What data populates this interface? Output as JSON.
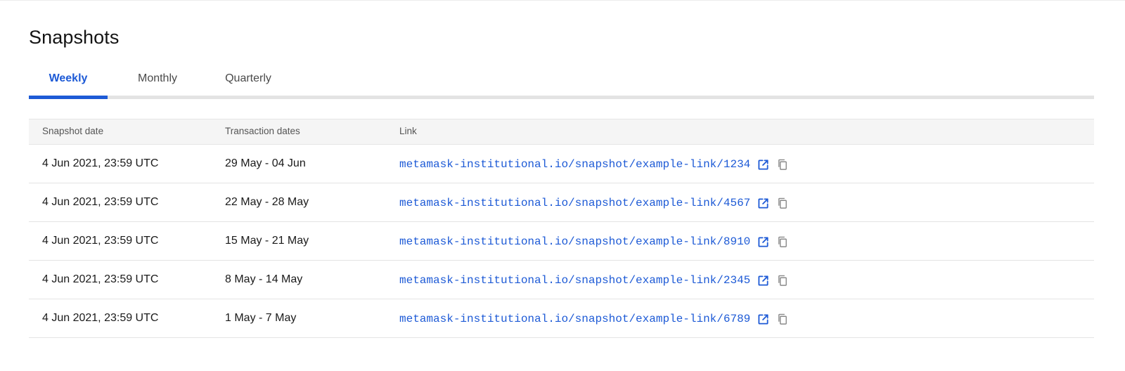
{
  "page": {
    "title": "Snapshots"
  },
  "tabs": [
    {
      "label": "Weekly",
      "active": true
    },
    {
      "label": "Monthly",
      "active": false
    },
    {
      "label": "Quarterly",
      "active": false
    }
  ],
  "table": {
    "headers": {
      "snapshot_date": "Snapshot date",
      "transaction_dates": "Transaction dates",
      "link": "Link"
    },
    "rows": [
      {
        "snapshot_date": "4 Jun 2021, 23:59 UTC",
        "transaction_dates": "29 May - 04 Jun",
        "link": "metamask-institutional.io/snapshot/example-link/1234"
      },
      {
        "snapshot_date": "4 Jun 2021, 23:59 UTC",
        "transaction_dates": "22 May - 28 May",
        "link": "metamask-institutional.io/snapshot/example-link/4567"
      },
      {
        "snapshot_date": "4 Jun 2021, 23:59 UTC",
        "transaction_dates": "15 May - 21 May",
        "link": "metamask-institutional.io/snapshot/example-link/8910"
      },
      {
        "snapshot_date": "4 Jun 2021, 23:59 UTC",
        "transaction_dates": "8 May - 14 May",
        "link": "metamask-institutional.io/snapshot/example-link/2345"
      },
      {
        "snapshot_date": "4 Jun 2021, 23:59 UTC",
        "transaction_dates": "1 May - 7 May",
        "link": "metamask-institutional.io/snapshot/example-link/6789"
      }
    ]
  },
  "icons": {
    "open": "external-link-icon",
    "copy": "copy-icon"
  },
  "colors": {
    "accent": "#1d5ad6",
    "tab_track": "#e3e3e3",
    "header_bg": "#f5f5f5",
    "copy_icon": "#8a8a8a"
  }
}
